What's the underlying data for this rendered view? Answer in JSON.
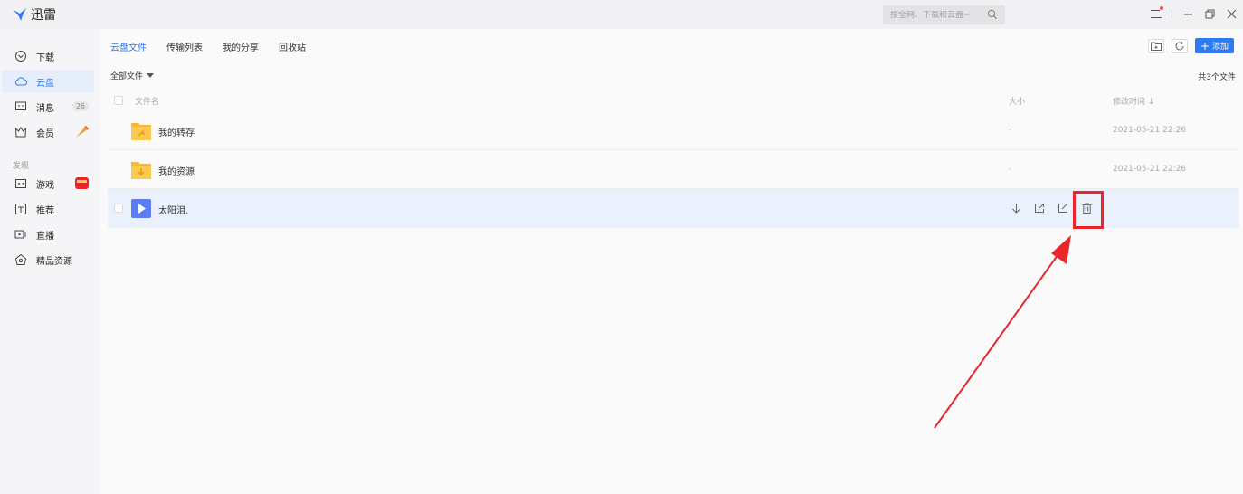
{
  "app": {
    "name": "迅雷"
  },
  "search": {
    "placeholder": "搜全网、下载和云盘~"
  },
  "sidebar": {
    "items": [
      {
        "label": "下载",
        "icon": "download-circle-icon"
      },
      {
        "label": "云盘",
        "icon": "cloud-icon",
        "active": true
      },
      {
        "label": "消息",
        "icon": "message-icon",
        "badge": "26"
      },
      {
        "label": "会员",
        "icon": "crown-icon"
      }
    ],
    "section": "发现",
    "discover": [
      {
        "label": "游戏",
        "icon": "gamepad-icon"
      },
      {
        "label": "推荐",
        "icon": "recommend-icon"
      },
      {
        "label": "直播",
        "icon": "live-icon"
      },
      {
        "label": "精品资源",
        "icon": "boutique-icon"
      }
    ]
  },
  "tabs": [
    {
      "label": "云盘文件",
      "active": true
    },
    {
      "label": "传输列表"
    },
    {
      "label": "我的分享"
    },
    {
      "label": "回收站"
    }
  ],
  "toolbar": {
    "add_label": "添加"
  },
  "breadcrumb": "全部文件",
  "file_count": "共3个文件",
  "columns": {
    "name": "文件名",
    "size": "大小",
    "time": "修改时间 ↓"
  },
  "files": [
    {
      "name": "我的转存",
      "size": "-",
      "time": "2021-05-21 22:26",
      "type": "folder"
    },
    {
      "name": "我的资源",
      "size": "-",
      "time": "2021-05-21 22:26",
      "type": "folder"
    },
    {
      "name": "太阳泪.",
      "type": "video"
    }
  ],
  "colors": {
    "accent": "#2e7af0",
    "folder": "#f7b731",
    "video": "#5b7cf2",
    "highlight": "#e8262b"
  }
}
